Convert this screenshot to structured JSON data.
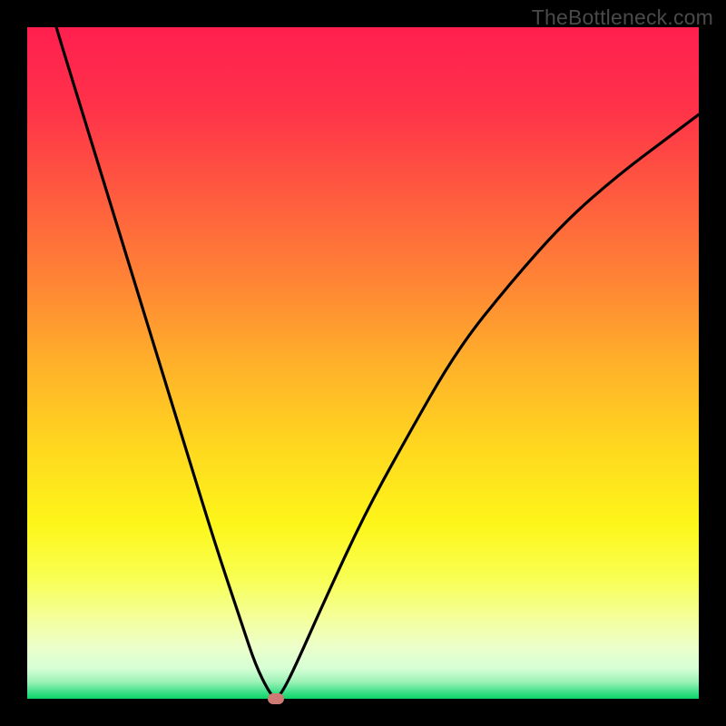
{
  "watermark": {
    "text": "TheBottleneck.com"
  },
  "chart_data": {
    "type": "line",
    "title": "",
    "xlabel": "",
    "ylabel": "",
    "xlim": [
      0,
      100
    ],
    "ylim": [
      0,
      100
    ],
    "grid": false,
    "legend": false,
    "gradient_stops": [
      {
        "pos": 0.0,
        "color": "#ff1f4f"
      },
      {
        "pos": 0.12,
        "color": "#ff3249"
      },
      {
        "pos": 0.25,
        "color": "#ff5b3f"
      },
      {
        "pos": 0.38,
        "color": "#ff8535"
      },
      {
        "pos": 0.5,
        "color": "#ffb02a"
      },
      {
        "pos": 0.62,
        "color": "#ffd61f"
      },
      {
        "pos": 0.74,
        "color": "#fdf61a"
      },
      {
        "pos": 0.82,
        "color": "#f8ff52"
      },
      {
        "pos": 0.88,
        "color": "#f4ff9b"
      },
      {
        "pos": 0.92,
        "color": "#edffc8"
      },
      {
        "pos": 0.955,
        "color": "#d6ffd6"
      },
      {
        "pos": 0.975,
        "color": "#9cf2b6"
      },
      {
        "pos": 0.99,
        "color": "#3ee089"
      },
      {
        "pos": 1.0,
        "color": "#0bd467"
      }
    ],
    "series": [
      {
        "name": "bottleneck-curve",
        "x": [
          0,
          4,
          8,
          12,
          16,
          20,
          24,
          28,
          32,
          34,
          36,
          37,
          38,
          40,
          44,
          50,
          56,
          64,
          72,
          80,
          88,
          96,
          100
        ],
        "y": [
          115,
          101,
          88,
          75,
          62,
          49,
          36,
          23,
          11,
          5,
          1,
          0,
          1,
          5,
          14,
          27,
          38,
          52,
          62,
          71,
          78,
          84,
          87
        ]
      }
    ],
    "marker": {
      "x": 37,
      "y": 0,
      "color": "#cf7a75"
    }
  }
}
